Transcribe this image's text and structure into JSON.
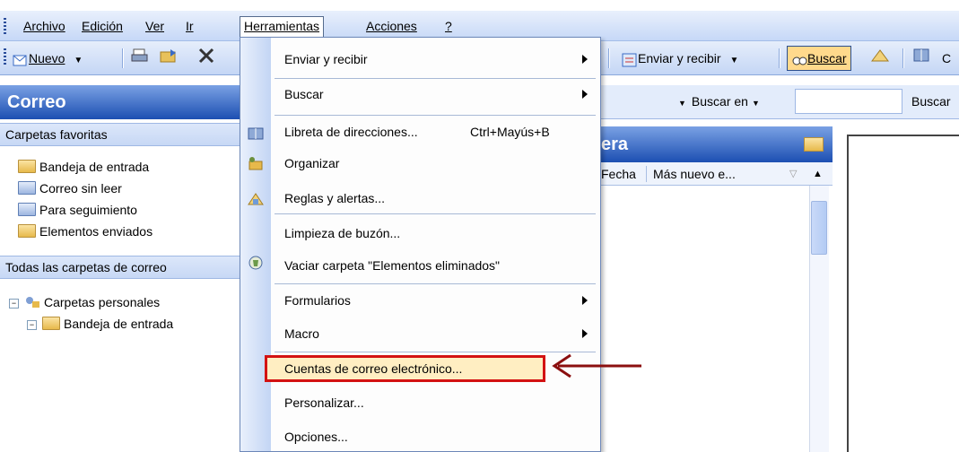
{
  "menubar": {
    "items": [
      "Archivo",
      "Edición",
      "Ver",
      "Ir",
      "Herramientas",
      "Acciones",
      "?"
    ]
  },
  "toolbar": {
    "nuevo_label": "Nuevo",
    "enviar_recibir_label": "Enviar y recibir",
    "buscar_label": "Buscar",
    "trailing_char": "C"
  },
  "left_pane": {
    "title": "Correo",
    "favorites_header": "Carpetas favoritas",
    "favorites": [
      "Bandeja de entrada",
      "Correo sin leer",
      "Para seguimiento",
      "Elementos enviados"
    ],
    "all_header": "Todas las carpetas de correo",
    "tree_root": "Carpetas personales",
    "tree_child": "Bandeja de entrada"
  },
  "search": {
    "buscar_en_label": "Buscar en",
    "buscar_label": "Buscar"
  },
  "message_list": {
    "title_fragment": "era",
    "col_fecha": "Fecha",
    "col_sort": "Más nuevo e..."
  },
  "dropdown": {
    "items": [
      {
        "label": "Enviar y recibir",
        "submenu": true
      },
      {
        "label": "Buscar",
        "submenu": true
      },
      {
        "label": "Libreta de direcciones...",
        "shortcut": "Ctrl+Mayús+B"
      },
      {
        "label": "Organizar"
      },
      {
        "label": "Reglas y alertas..."
      },
      {
        "label": "Limpieza de buzón..."
      },
      {
        "label": "Vaciar carpeta \"Elementos eliminados\""
      },
      {
        "label": "Formularios",
        "submenu": true
      },
      {
        "label": "Macro",
        "submenu": true
      },
      {
        "label": "Cuentas de correo electrónico...",
        "highlighted": true
      },
      {
        "label": "Personalizar..."
      },
      {
        "label": "Opciones..."
      }
    ]
  },
  "colors": {
    "header_blue": "#1c4fb2",
    "highlight_border": "#d31212",
    "arrow": "#8b0f0f"
  }
}
